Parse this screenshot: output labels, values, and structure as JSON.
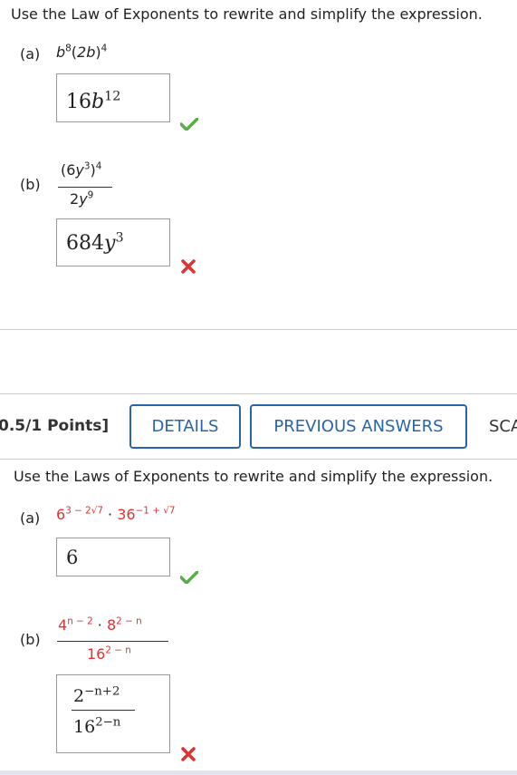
{
  "q1": {
    "prompt": "Use the Law of Exponents to rewrite and simplify the expression.",
    "a": {
      "label": "(a)",
      "expr_base": "b",
      "expr_exp1": "8",
      "expr_mid": "(2b)",
      "expr_exp2": "4",
      "answer_coef": "16",
      "answer_var": "b",
      "answer_exp": "12",
      "status": "correct"
    },
    "b": {
      "label": "(b)",
      "num_text": "(6y",
      "num_exp_inner": "3",
      "num_close": ")",
      "num_exp_outer": "4",
      "den_text": "2y",
      "den_exp": "9",
      "answer_coef": "684",
      "answer_var": "y",
      "answer_exp": "3",
      "status": "incorrect"
    }
  },
  "q2": {
    "points": "0.5/1 Points]",
    "buttons": {
      "details": "DETAILS",
      "previous_answers": "PREVIOUS ANSWERS",
      "submit_partial": "SCA"
    },
    "prompt": "Use the Laws of Exponents to rewrite and simplify the expression.",
    "a": {
      "label": "(a)",
      "base1": "6",
      "exp1": "3 − 2√7",
      "dot": "·",
      "base2": "36",
      "exp2": "−1 + √7",
      "answer": "6",
      "status": "correct"
    },
    "b": {
      "label": "(b)",
      "num_b1": "4",
      "num_e1": "n − 2",
      "num_dot": "·",
      "num_b2": "8",
      "num_e2": "2 − n",
      "den_b": "16",
      "den_e": "2 − n",
      "answer_num_base": "2",
      "answer_num_exp": "−n+2",
      "answer_den_base": "16",
      "answer_den_exp": "2−n",
      "status": "incorrect"
    }
  },
  "colors": {
    "accent": "#2a64a8",
    "correct": "#5aab4a",
    "incorrect": "#dd3333",
    "highlight": "#d33"
  },
  "icons": {
    "correct": "check-icon",
    "incorrect": "x-icon"
  }
}
